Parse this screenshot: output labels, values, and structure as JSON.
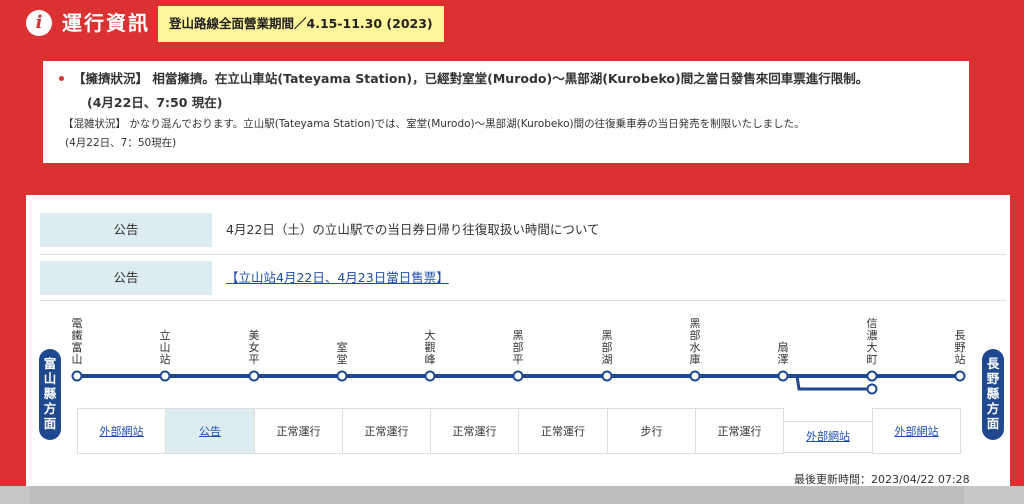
{
  "header": {
    "icon": "info-icon",
    "title": "運行資訊",
    "season_badge": "登山路線全面營業期間／4.15-11.30 (2023)"
  },
  "notice": {
    "zh_line": "【擁擠狀況】 相當擁擠。在立山車站(Tateyama Station)，已經對室堂(Murodo)〜黒部湖(Kurobeko)間之當日發售來回車票進行限制。",
    "zh_time": "(4月22日、7:50 現在)",
    "ja_line": "【混雑状況】 かなり混んでおります。立山駅(Tateyama Station)では、室堂(Murodo)〜黒部湖(Kurobeko)間の往復乗車券の当日発売を制限いたしました。",
    "ja_time": "(4月22日、7：50現在)"
  },
  "announcements": [
    {
      "tag": "公告",
      "text": "4月22日（土）の立山駅での当日券日帰り往復取扱い時間について",
      "is_link": false
    },
    {
      "tag": "公告",
      "text": "【立山站4月22日、4月23日當日售票】",
      "is_link": true
    }
  ],
  "route": {
    "left_direction": "富山縣方面",
    "right_direction": "長野縣方面",
    "line_color": "#20488f",
    "stations": [
      "電鐵富山",
      "立山站",
      "美女平",
      "室堂",
      "大觀峰",
      "黑部平",
      "黑部湖",
      "黑部水庫",
      "扇澤",
      "信濃大町",
      "長野站"
    ]
  },
  "segments": [
    {
      "label": "外部網站",
      "type": "link"
    },
    {
      "label": "公告",
      "type": "link-highlight"
    },
    {
      "label": "正常運行",
      "type": "text"
    },
    {
      "label": "正常運行",
      "type": "text"
    },
    {
      "label": "正常運行",
      "type": "text"
    },
    {
      "label": "正常運行",
      "type": "text"
    },
    {
      "label": "步行",
      "type": "text"
    },
    {
      "label": "正常運行",
      "type": "text"
    },
    {
      "label": "外部網站",
      "type": "link"
    },
    {
      "label": "外部網站",
      "type": "link"
    }
  ],
  "last_updated": "最後更新時間：2023/04/22 07:28",
  "colors": {
    "brand_red": "#dc3132",
    "badge_yellow": "#fff59a",
    "tag_bg": "#dcecef"
  }
}
